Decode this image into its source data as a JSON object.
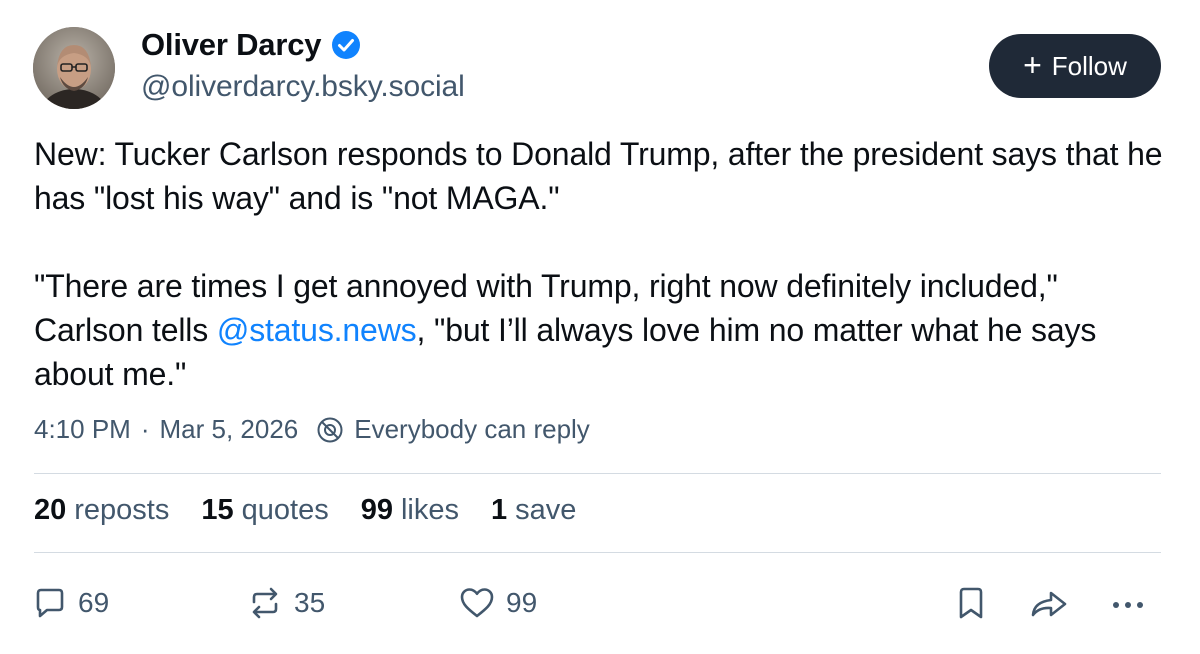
{
  "author": {
    "display_name": "Oliver Darcy",
    "handle": "@oliverdarcy.bsky.social",
    "verified": true
  },
  "follow_button": {
    "label": "Follow"
  },
  "post": {
    "paragraph1": "New: Tucker Carlson responds to Donald Trump, after the president says that he has \"lost his way\" and is \"not MAGA.\"",
    "paragraph2_before": "\"There are times I get annoyed with Trump, right now definitely included,\" Carlson tells ",
    "mention": "@status.news",
    "paragraph2_after": ", \"but I’ll always love him no matter what he says about me.\""
  },
  "meta": {
    "time": "4:10 PM",
    "separator": "·",
    "date": "Mar 5, 2026",
    "reply_setting": "Everybody can reply"
  },
  "stats": [
    {
      "count": "20",
      "label": "reposts"
    },
    {
      "count": "15",
      "label": "quotes"
    },
    {
      "count": "99",
      "label": "likes"
    },
    {
      "count": "1",
      "label": "save"
    }
  ],
  "actions": {
    "reply_count": "69",
    "repost_count": "35",
    "like_count": "99"
  },
  "colors": {
    "accent": "#1083fe",
    "verified": "#1083fe",
    "follow_bg": "#1f2937",
    "muted_text": "#42576c"
  }
}
